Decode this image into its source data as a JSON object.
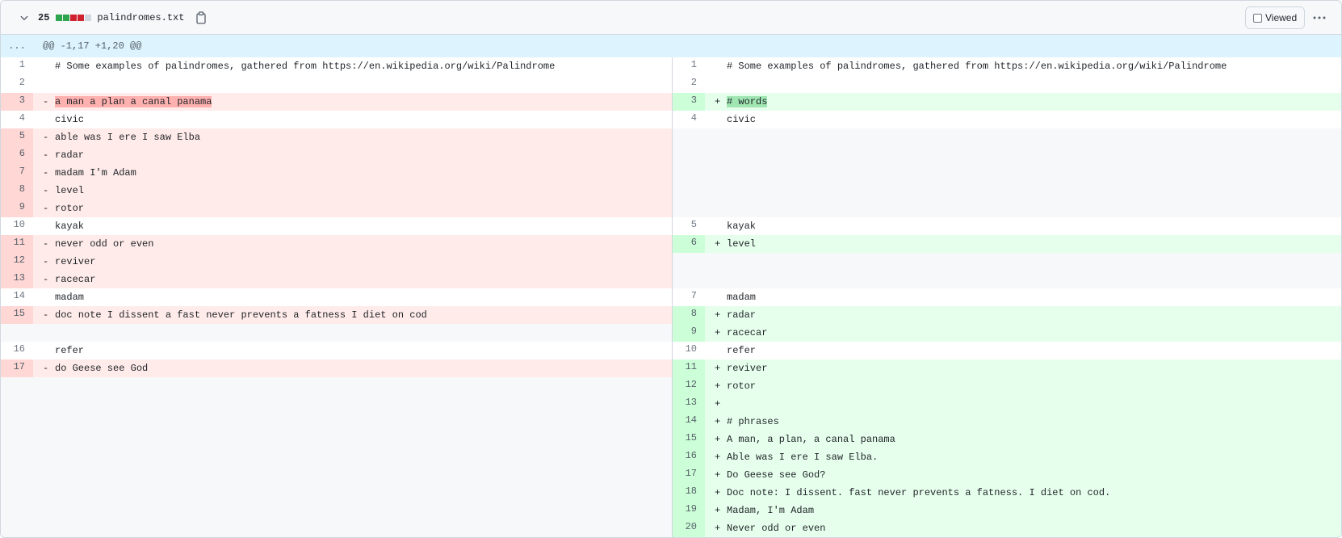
{
  "file": {
    "changes_count": "25",
    "diffstat": [
      "#2da44e",
      "#2da44e",
      "#cf222e",
      "#cf222e",
      "#d0d7de"
    ],
    "name": "palindromes.txt",
    "viewed_label": "Viewed",
    "icons": {
      "collapse": "chevron-down-icon",
      "copy": "copy-icon",
      "more": "kebab-horizontal-icon"
    }
  },
  "hunk": {
    "expander": "...",
    "header": "@@ -1,17 +1,20 @@"
  },
  "rows": [
    {
      "l_type": "ctx",
      "l_num": "1",
      "l_mark": "",
      "l_code": "# Some examples of palindromes, gathered from https://en.wikipedia.org/wiki/Palindrome",
      "r_type": "ctx",
      "r_num": "1",
      "r_mark": "",
      "r_code": "# Some examples of palindromes, gathered from https://en.wikipedia.org/wiki/Palindrome"
    },
    {
      "l_type": "ctx",
      "l_num": "2",
      "l_mark": "",
      "l_code": "",
      "r_type": "ctx",
      "r_num": "2",
      "r_mark": "",
      "r_code": ""
    },
    {
      "l_type": "del",
      "l_num": "3",
      "l_mark": "-",
      "l_code": "a man a plan a canal panama",
      "l_hl": true,
      "r_type": "add",
      "r_num": "3",
      "r_mark": "+",
      "r_code": "# words",
      "r_hl": true
    },
    {
      "l_type": "ctx",
      "l_num": "4",
      "l_mark": "",
      "l_code": "civic",
      "r_type": "ctx",
      "r_num": "4",
      "r_mark": "",
      "r_code": "civic"
    },
    {
      "l_type": "del",
      "l_num": "5",
      "l_mark": "-",
      "l_code": "able was I ere I saw Elba",
      "r_type": "empty",
      "r_num": "",
      "r_mark": "",
      "r_code": ""
    },
    {
      "l_type": "del",
      "l_num": "6",
      "l_mark": "-",
      "l_code": "radar",
      "r_type": "empty",
      "r_num": "",
      "r_mark": "",
      "r_code": ""
    },
    {
      "l_type": "del",
      "l_num": "7",
      "l_mark": "-",
      "l_code": "madam I'm Adam",
      "r_type": "empty",
      "r_num": "",
      "r_mark": "",
      "r_code": ""
    },
    {
      "l_type": "del",
      "l_num": "8",
      "l_mark": "-",
      "l_code": "level",
      "r_type": "empty",
      "r_num": "",
      "r_mark": "",
      "r_code": ""
    },
    {
      "l_type": "del",
      "l_num": "9",
      "l_mark": "-",
      "l_code": "rotor",
      "r_type": "empty",
      "r_num": "",
      "r_mark": "",
      "r_code": ""
    },
    {
      "l_type": "ctx",
      "l_num": "10",
      "l_mark": "",
      "l_code": "kayak",
      "r_type": "ctx",
      "r_num": "5",
      "r_mark": "",
      "r_code": "kayak"
    },
    {
      "l_type": "del",
      "l_num": "11",
      "l_mark": "-",
      "l_code": "never odd or even",
      "r_type": "add",
      "r_num": "6",
      "r_mark": "+",
      "r_code": "level"
    },
    {
      "l_type": "del",
      "l_num": "12",
      "l_mark": "-",
      "l_code": "reviver",
      "r_type": "empty",
      "r_num": "",
      "r_mark": "",
      "r_code": ""
    },
    {
      "l_type": "del",
      "l_num": "13",
      "l_mark": "-",
      "l_code": "racecar",
      "r_type": "empty",
      "r_num": "",
      "r_mark": "",
      "r_code": ""
    },
    {
      "l_type": "ctx",
      "l_num": "14",
      "l_mark": "",
      "l_code": "madam",
      "r_type": "ctx",
      "r_num": "7",
      "r_mark": "",
      "r_code": "madam"
    },
    {
      "l_type": "del",
      "l_num": "15",
      "l_mark": "-",
      "l_code": "doc note I dissent a fast never prevents a fatness I diet on cod",
      "r_type": "add",
      "r_num": "8",
      "r_mark": "+",
      "r_code": "radar"
    },
    {
      "l_type": "empty",
      "l_num": "",
      "l_mark": "",
      "l_code": "",
      "r_type": "add",
      "r_num": "9",
      "r_mark": "+",
      "r_code": "racecar"
    },
    {
      "l_type": "ctx",
      "l_num": "16",
      "l_mark": "",
      "l_code": "refer",
      "r_type": "ctx",
      "r_num": "10",
      "r_mark": "",
      "r_code": "refer"
    },
    {
      "l_type": "del",
      "l_num": "17",
      "l_mark": "-",
      "l_code": "do Geese see God",
      "r_type": "add",
      "r_num": "11",
      "r_mark": "+",
      "r_code": "reviver"
    },
    {
      "l_type": "empty",
      "l_num": "",
      "l_mark": "",
      "l_code": "",
      "r_type": "add",
      "r_num": "12",
      "r_mark": "+",
      "r_code": "rotor"
    },
    {
      "l_type": "empty",
      "l_num": "",
      "l_mark": "",
      "l_code": "",
      "r_type": "add",
      "r_num": "13",
      "r_mark": "+",
      "r_code": ""
    },
    {
      "l_type": "empty",
      "l_num": "",
      "l_mark": "",
      "l_code": "",
      "r_type": "add",
      "r_num": "14",
      "r_mark": "+",
      "r_code": "# phrases"
    },
    {
      "l_type": "empty",
      "l_num": "",
      "l_mark": "",
      "l_code": "",
      "r_type": "add",
      "r_num": "15",
      "r_mark": "+",
      "r_code": "A man, a plan, a canal panama"
    },
    {
      "l_type": "empty",
      "l_num": "",
      "l_mark": "",
      "l_code": "",
      "r_type": "add",
      "r_num": "16",
      "r_mark": "+",
      "r_code": "Able was I ere I saw Elba."
    },
    {
      "l_type": "empty",
      "l_num": "",
      "l_mark": "",
      "l_code": "",
      "r_type": "add",
      "r_num": "17",
      "r_mark": "+",
      "r_code": "Do Geese see God?"
    },
    {
      "l_type": "empty",
      "l_num": "",
      "l_mark": "",
      "l_code": "",
      "r_type": "add",
      "r_num": "18",
      "r_mark": "+",
      "r_code": "Doc note: I dissent. fast never prevents a fatness. I diet on cod."
    },
    {
      "l_type": "empty",
      "l_num": "",
      "l_mark": "",
      "l_code": "",
      "r_type": "add",
      "r_num": "19",
      "r_mark": "+",
      "r_code": "Madam, I'm Adam"
    },
    {
      "l_type": "empty",
      "l_num": "",
      "l_mark": "",
      "l_code": "",
      "r_type": "add",
      "r_num": "20",
      "r_mark": "+",
      "r_code": "Never odd or even"
    }
  ]
}
